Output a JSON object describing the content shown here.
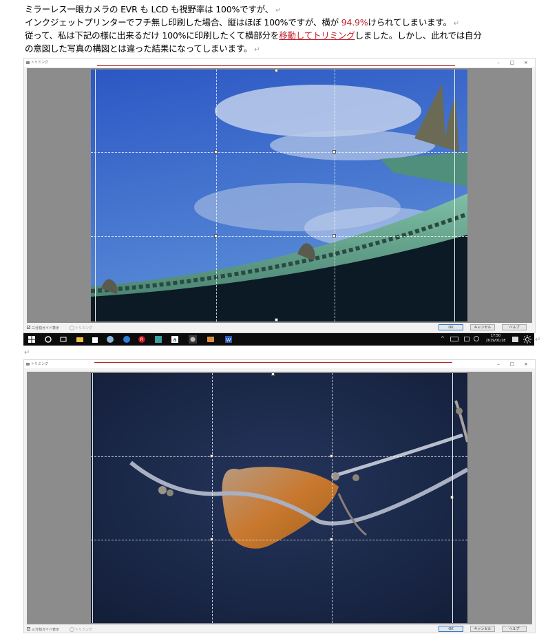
{
  "document": {
    "line1_a": "ミラーレス一眼カメラの EVR も LCD も視野率は 100%ですが、",
    "line2_a": "インクジェットプリンターでフチ無し印刷した場合、縦はほぼ 100%ですが、横が ",
    "line2_red": "94.9%",
    "line2_b": "けられてしまいます。",
    "line3_a": "従って、私は下記の様に出来るだけ 100%に印刷したくて横部分を",
    "line3_link": "移動してトリミング",
    "line3_b": "しました。しかし、此れでは自分",
    "line4": "の意図した写真の構図とは違った結果になってしまいます。",
    "return_mark": "↵"
  },
  "dialog1": {
    "title": "トリミング",
    "minimize": "–",
    "maximize": "□",
    "close": "×",
    "checkbox_label": "三分割ガイド表示",
    "option_label": "トリミング",
    "ok": "OK",
    "cancel": "キャンセル",
    "help": "ヘルプ",
    "photo_desc_icon": "temple-roof-photo"
  },
  "taskbar": {
    "time": "17:50",
    "date": "2019/01/18",
    "icons": [
      "windows-start-icon",
      "cortana-icon",
      "task-view-icon",
      "file-explorer-icon",
      "store-icon",
      "chrome-icon",
      "edge-icon",
      "rakuten-icon",
      "app-icon",
      "amazon-icon",
      "photo-app-icon",
      "photo-viewer-icon",
      "word-icon"
    ]
  },
  "dialog2": {
    "title": "トリミング",
    "minimize": "–",
    "maximize": "□",
    "close": "×",
    "checkbox_label": "三分割ガイド表示",
    "option_label": "トリミング",
    "ok": "OK",
    "cancel": "キャンセル",
    "help": "ヘルプ"
  },
  "colors": {
    "accent_red": "#c0202a",
    "taskbar": "#0c0c0c",
    "canvas_gray": "#8c8c8c"
  }
}
